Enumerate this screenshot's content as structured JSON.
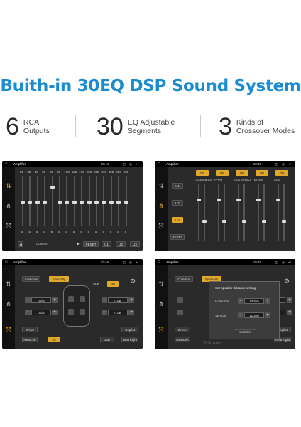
{
  "headline": "Buith-in 30EQ DSP Sound System",
  "features": [
    {
      "num": "6",
      "line1": "RCA",
      "line2": "Outputs"
    },
    {
      "num": "30",
      "line1": "EQ Adjustable",
      "line2": "Segments"
    },
    {
      "num": "3",
      "line1": "Kinds of",
      "line2": "Crossover Modes"
    }
  ],
  "screens": {
    "eq": {
      "app_title": "Amplifier",
      "time": "10:44",
      "freqs": [
        "25",
        "32",
        "40",
        "50",
        "63",
        "80",
        "100",
        "125",
        "160",
        "200",
        "250",
        "315",
        "400",
        "500",
        "630"
      ],
      "levels": [
        5,
        5,
        5,
        5,
        8,
        5,
        5,
        5,
        5,
        5,
        5,
        5,
        5,
        5,
        5
      ],
      "preset": "Custom",
      "reset": "RESET",
      "u1": "U1",
      "u2": "U2",
      "u3": "U3",
      "prev": "◀",
      "next": "▶"
    },
    "crossover": {
      "app_title": "Amplifier",
      "time": "10:45",
      "u1": "U1",
      "u2": "U2",
      "u3": "U3",
      "reset": "RESET",
      "cols": [
        {
          "on": "ON",
          "label": "LOUDNESS"
        },
        {
          "on": "ON",
          "label": "PHAT"
        },
        {
          "on": "ON",
          "label": "CUT FREQ"
        },
        {
          "on": "ON",
          "label": "BASS"
        },
        {
          "on": "ON",
          "label": "SUB"
        }
      ]
    },
    "balance": {
      "app_title": "Amplifier",
      "time": "10:46",
      "common": "Common",
      "specialty": "Specialty",
      "fader": "Fader",
      "on": "ON",
      "db_values": [
        "0 dB",
        "0 dB",
        "0 dB",
        "0 dB"
      ],
      "driver": "Driver",
      "copilot": "Copilot",
      "rear_left": "RearLeft",
      "all": "All",
      "user": "User",
      "rear_right": "RearRight"
    },
    "distance": {
      "app_title": "Amplifier",
      "time": "10:46",
      "common": "Common",
      "specialty": "Specialty",
      "dialog_title": "Car speaker distance setting",
      "horizontal_label": "Horizontal",
      "horizontal_value": "140cm",
      "vertical_label": "Vertical",
      "vertical_value": "110cm",
      "confirm": "Confirm",
      "driver": "Driver",
      "copilot": "Copilot",
      "rear_left": "RearLeft",
      "rear_right": "RearRight",
      "watermark": "Seicane"
    }
  },
  "colors": {
    "accent": "#1b8ccf",
    "active": "#e0a82a"
  }
}
